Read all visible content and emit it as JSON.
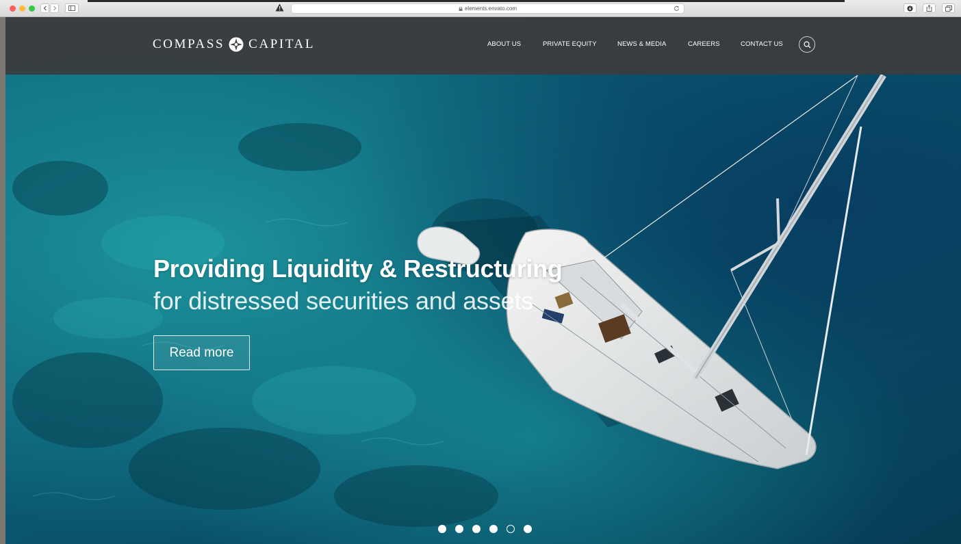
{
  "browser": {
    "url": "elements.envato.com"
  },
  "navbar": {
    "logo_left": "COMPASS",
    "logo_right": "CAPITAL",
    "links": [
      {
        "label": "ABOUT US"
      },
      {
        "label": "PRIVATE EQUITY"
      },
      {
        "label": "NEWS & MEDIA"
      },
      {
        "label": "CAREERS"
      },
      {
        "label": "CONTACT US"
      }
    ],
    "search_icon": "search-icon"
  },
  "hero": {
    "title": "Providing Liquidity & Restructuring",
    "subtitle": "for distressed securities and assets",
    "cta_label": "Read more"
  },
  "slider": {
    "total": 6,
    "active_index": 4
  },
  "colors": {
    "navbar": "#3a3c3e",
    "water": "#0e5a73",
    "accent_white": "#ffffff"
  }
}
